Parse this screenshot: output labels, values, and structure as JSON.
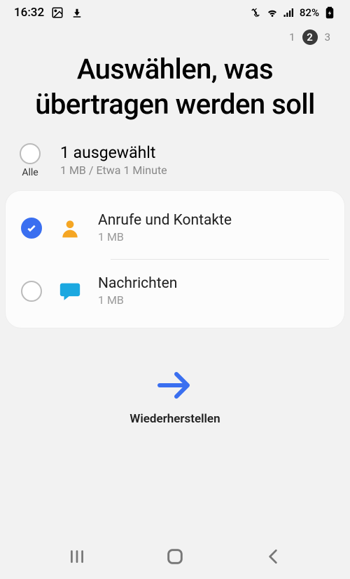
{
  "status": {
    "time": "16:32",
    "battery": "82%"
  },
  "pager": {
    "step1": "1",
    "step2": "2",
    "step3": "3"
  },
  "title": "Auswählen, was übertragen werden soll",
  "summary": {
    "all_label": "Alle",
    "selected": "1 ausgewählt",
    "detail": "1 MB / Etwa 1 Minute"
  },
  "items": [
    {
      "title": "Anrufe und Kontakte",
      "size": "1 MB",
      "checked": true,
      "icon": "person"
    },
    {
      "title": "Nachrichten",
      "size": "1 MB",
      "checked": false,
      "icon": "message"
    }
  ],
  "restore_label": "Wiederherstellen"
}
